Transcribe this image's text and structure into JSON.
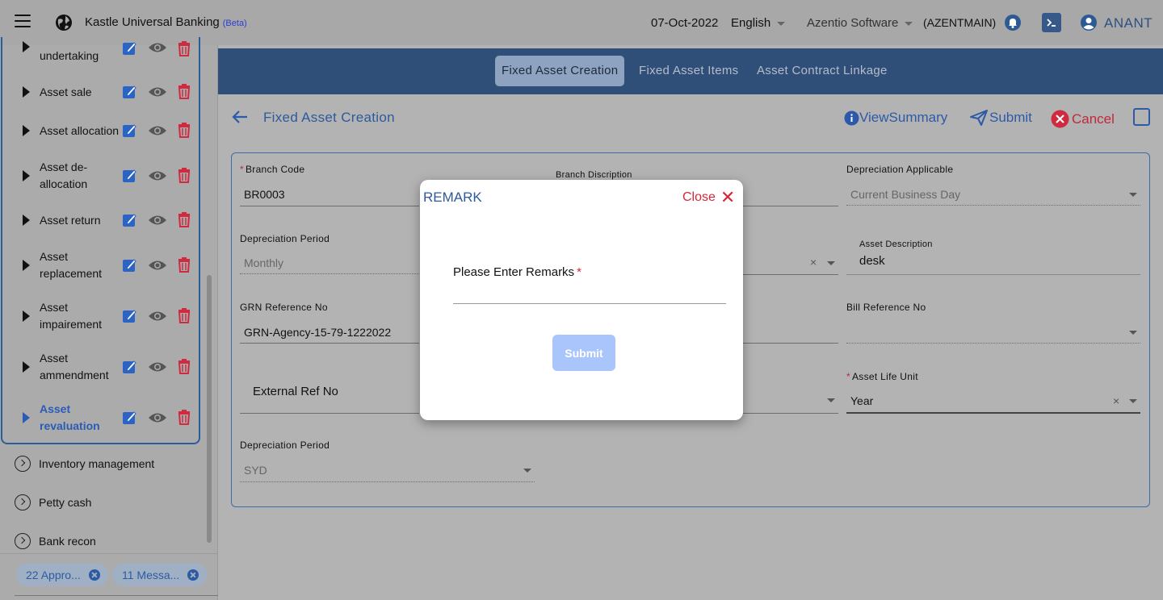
{
  "app": {
    "title": "Kastle Universal Banking",
    "beta": "(Beta)",
    "date": "07-Oct-2022",
    "language": "English",
    "company": "Azentio Software",
    "entity": "(AZENTMAIN)",
    "user": "ANANT"
  },
  "sidebar": {
    "items": [
      {
        "label": "undertaking"
      },
      {
        "label": "Asset sale"
      },
      {
        "label": "Asset allocation"
      },
      {
        "label": "Asset de-allocation"
      },
      {
        "label": "Asset return"
      },
      {
        "label": "Asset replacement"
      },
      {
        "label": "Asset impairement"
      },
      {
        "label": "Asset ammendment"
      },
      {
        "label": "Asset revaluation"
      }
    ],
    "nav": [
      {
        "label": "Inventory management"
      },
      {
        "label": "Petty cash"
      },
      {
        "label": "Bank recon"
      }
    ],
    "chips": [
      {
        "label": "22 Appro..."
      },
      {
        "label": "11 Messa..."
      }
    ]
  },
  "tabs": [
    {
      "label": "Fixed Asset Creation"
    },
    {
      "label": "Fixed Asset Items"
    },
    {
      "label": "Asset Contract Linkage"
    }
  ],
  "page": {
    "title": "Fixed Asset Creation",
    "view_summary": "ViewSummary",
    "submit": "Submit",
    "cancel": "Cancel"
  },
  "form": {
    "branch_code_label": "Branch Code",
    "branch_code": "BR0003",
    "branch_description_label": "Branch Discription",
    "depreciation_applicable_label": "Depreciation Applicable",
    "depreciation_applicable": "Current Business Day",
    "depreciation_period_label": "Depreciation Period",
    "depreciation_period": "Monthly",
    "asset_description_label": "Asset Description",
    "asset_description": "desk",
    "grn_reference_label": "GRN Reference No",
    "grn_reference": "GRN-Agency-15-79-1222022",
    "bill_reference_label": "Bill Reference No",
    "external_ref_label": "External Ref No",
    "asset_life_unit_label": "Asset Life Unit",
    "asset_life_unit": "Year",
    "depreciation_period2_label": "Depreciation Period",
    "depreciation_period2": "SYD"
  },
  "modal": {
    "title": "REMARK",
    "close": "Close",
    "close_glyph": "✕",
    "label": "Please Enter Remarks",
    "required_mark": "*",
    "submit": "Submit"
  }
}
